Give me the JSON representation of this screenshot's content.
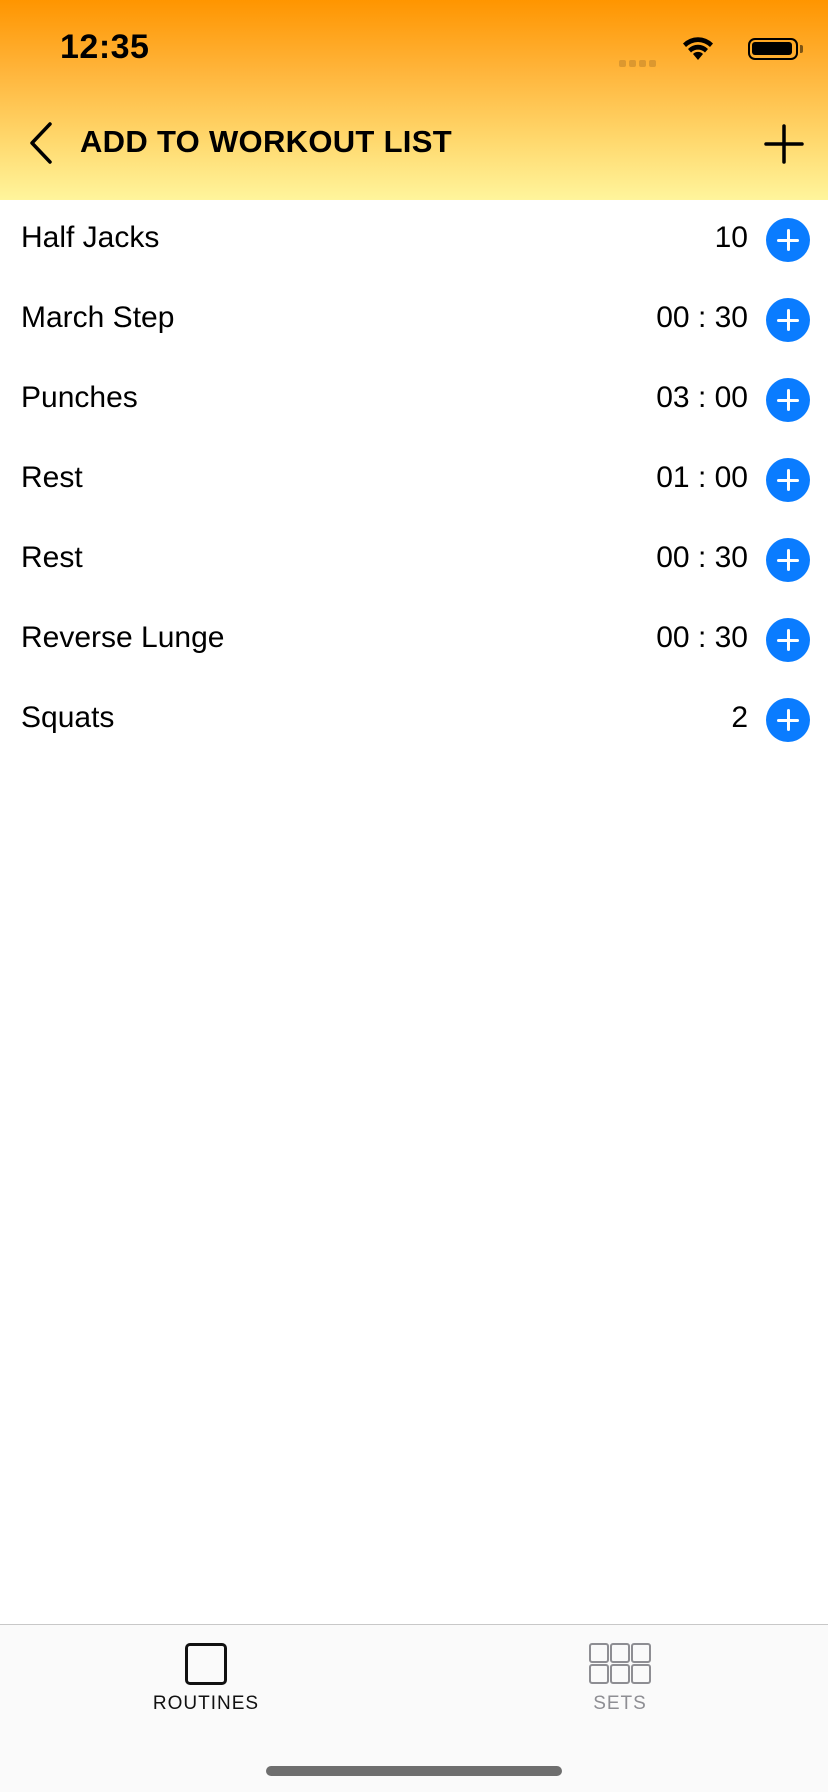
{
  "status_bar": {
    "time": "12:35"
  },
  "nav": {
    "title": "ADD TO WORKOUT LIST",
    "back_icon": "chevron-left-icon",
    "add_icon": "plus-icon"
  },
  "exercises": [
    {
      "name": "Half Jacks",
      "value": "10"
    },
    {
      "name": "March Step",
      "value": "00 : 30"
    },
    {
      "name": "Punches",
      "value": "03 : 00"
    },
    {
      "name": "Rest",
      "value": "01 : 00"
    },
    {
      "name": "Rest",
      "value": "00 : 30"
    },
    {
      "name": "Reverse Lunge",
      "value": "00 : 30"
    },
    {
      "name": "Squats",
      "value": "2"
    }
  ],
  "tabbar": {
    "tabs": [
      {
        "label": "ROUTINES",
        "icon": "square-icon",
        "selected": true
      },
      {
        "label": "SETS",
        "icon": "grid-icon",
        "selected": false
      }
    ]
  },
  "colors": {
    "header_top": "#ff9500",
    "header_bottom": "#fff59c",
    "accent_blue": "#0a7cff",
    "inactive_gray": "#8e8e93"
  }
}
